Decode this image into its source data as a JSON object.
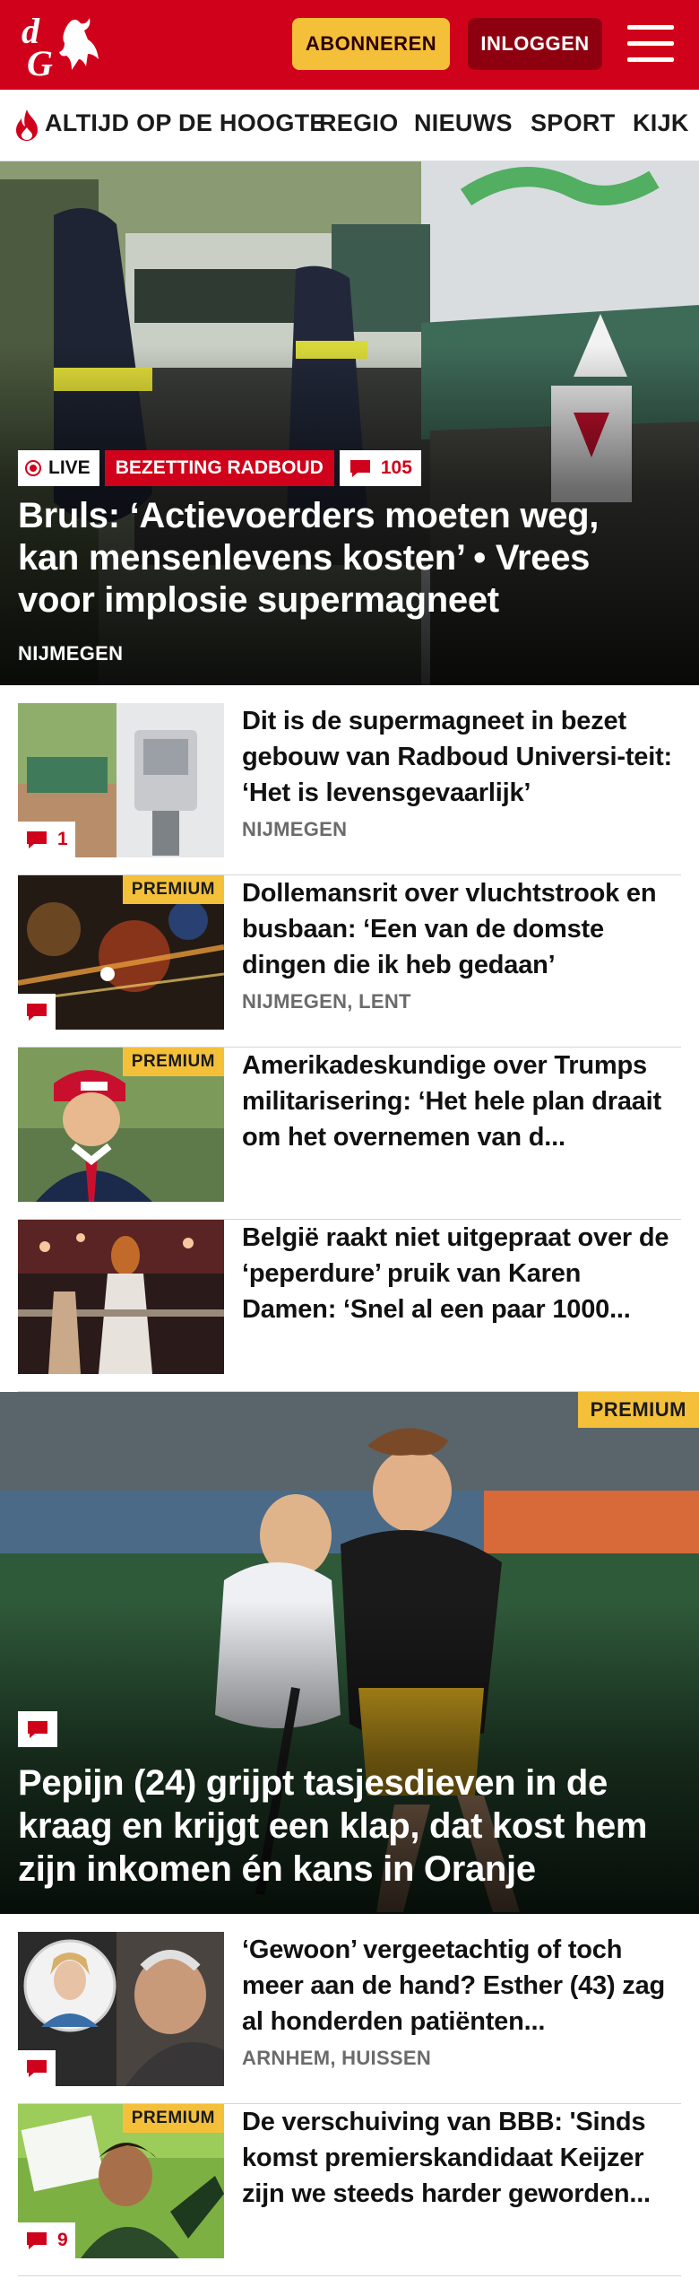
{
  "header": {
    "subscribe_label": "ABONNEREN",
    "login_label": "INLOGGEN",
    "brand_color": "#d0021b",
    "subscribe_color": "#f5c039"
  },
  "nav": {
    "items": [
      "ALTIJD OP DE HOOGTE",
      "REGIO",
      "NIEUWS",
      "SPORT",
      "KIJK"
    ]
  },
  "hero": {
    "live_label": "LIVE",
    "topic_label": "BEZETTING RADBOUD",
    "comment_count": "105",
    "title": "Bruls: ‘Actievoerders moeten weg, kan mensenlevens kosten’ • Vrees voor implosie supermagneet",
    "location": "NIJMEGEN"
  },
  "articles": [
    {
      "title": "Dit is de supermagneet in bezet gebouw van Radboud Universi-teit: ‘Het is levensgevaarlijk’",
      "location": "NIJMEGEN",
      "comment_count": "1",
      "premium": ""
    },
    {
      "title": "Dollemansrit over vluchtstrook en busbaan: ‘Een van de domste dingen die ik heb gedaan’",
      "location": "NIJMEGEN, LENT",
      "comment_count": "",
      "premium": "PREMIUM"
    },
    {
      "title": "Amerikadeskundige over Trumps militarisering: ‘Het hele plan draait om het overnemen van d...",
      "location": "",
      "comment_count": "",
      "premium": "PREMIUM"
    },
    {
      "title": "België raakt niet uitgepraat over de ‘peperdure’ pruik van Karen Damen: ‘Snel al een paar 1000...",
      "location": "",
      "comment_count": "",
      "premium": ""
    }
  ],
  "feature": {
    "premium": "PREMIUM",
    "title": "Pepijn (24) grijpt tasjesdieven in de kraag en krijgt een klap, dat kost hem zijn inkomen én kans in Oranje"
  },
  "articles2": [
    {
      "title": "‘Gewoon’ vergeetachtig of toch meer aan de hand? Esther (43) zag al honderden patiënten...",
      "location": "ARNHEM, HUISSEN",
      "comment_count": "",
      "premium": ""
    },
    {
      "title": "De verschuiving van BBB: 'Sinds komst premierskandidaat Keijzer zijn we steeds harder geworden...",
      "location": "",
      "comment_count": "9",
      "premium": "PREMIUM"
    }
  ]
}
